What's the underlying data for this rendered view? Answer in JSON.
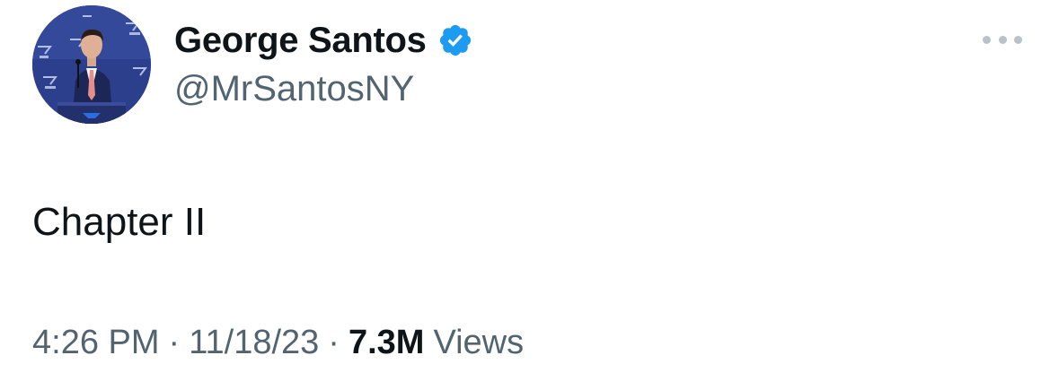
{
  "author": {
    "display_name": "George Santos",
    "handle": "@MrSantosNY",
    "verified": true,
    "verified_color": "#1d9bf0",
    "avatar_icon": "profile-photo"
  },
  "tweet": {
    "text": "Chapter II"
  },
  "meta": {
    "time": "4:26 PM",
    "separator": "·",
    "date": "11/18/23",
    "views_count": "7.3M",
    "views_label": "Views"
  },
  "actions": {
    "more_icon": "more-horizontal-icon"
  },
  "colors": {
    "text_primary": "#0f1419",
    "text_secondary": "#536471",
    "more_dots": "#b9c2ca"
  }
}
